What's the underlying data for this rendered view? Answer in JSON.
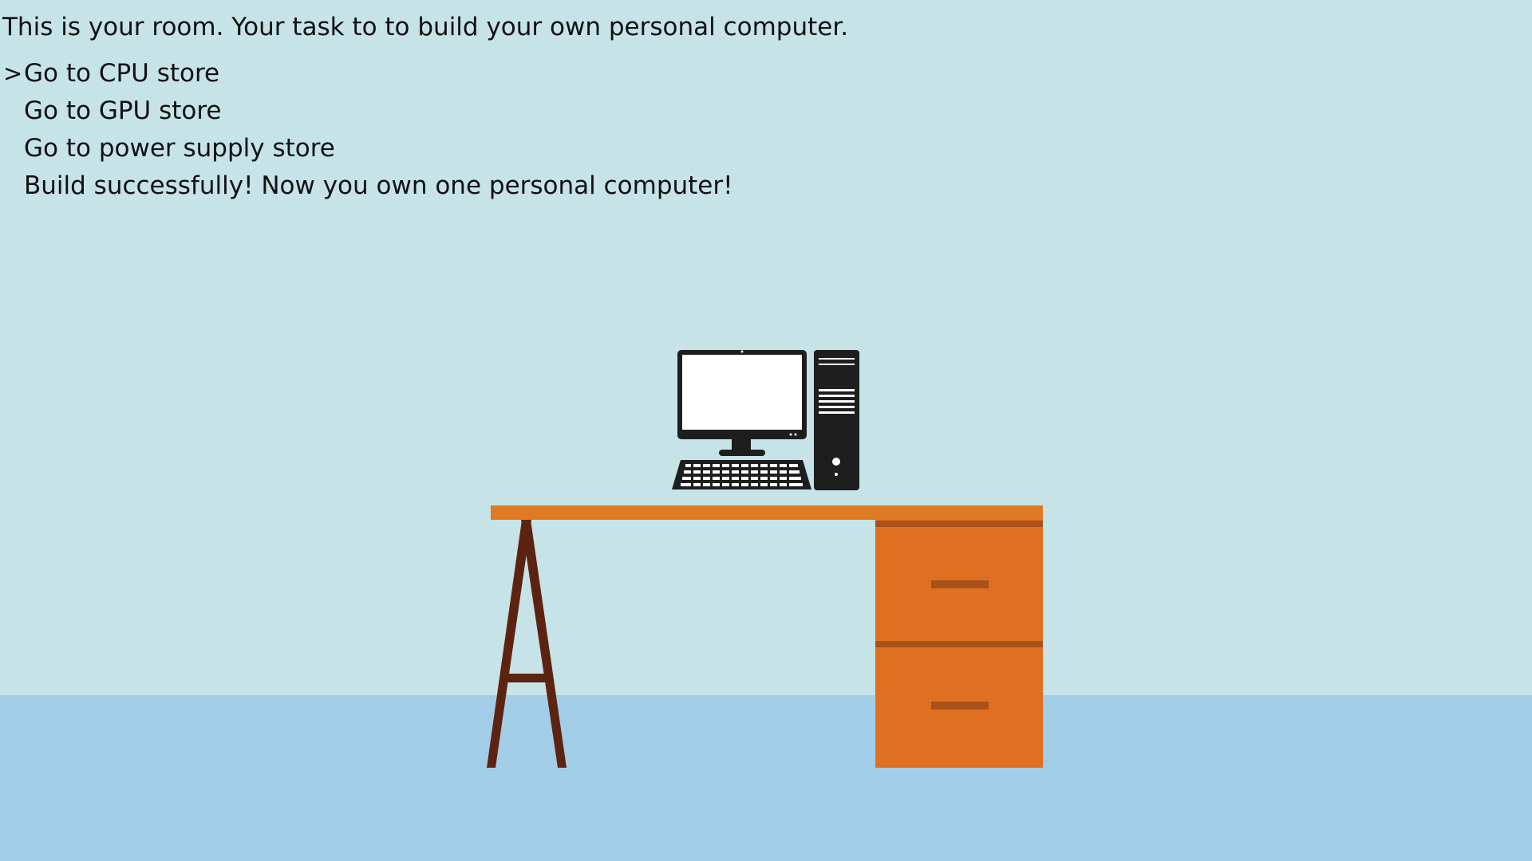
{
  "intro_text": "This is your room. Your task to to build your own personal computer.",
  "cursor_glyph": ">",
  "selected_index": 0,
  "menu": {
    "items": [
      {
        "label": "Go to CPU store"
      },
      {
        "label": "Go to GPU store"
      },
      {
        "label": "Go to power supply store"
      },
      {
        "label": "Build successfully! Now you own one personal computer!"
      }
    ]
  },
  "colors": {
    "wall": "#c6e3e8",
    "floor": "#a2cde6",
    "desk_top": "#e07a22",
    "desk_leg": "#5c2410",
    "drawer_handle": "#a8511a",
    "computer": "#1e1e1e"
  },
  "icons": {
    "computer": "desktop-computer-icon"
  }
}
